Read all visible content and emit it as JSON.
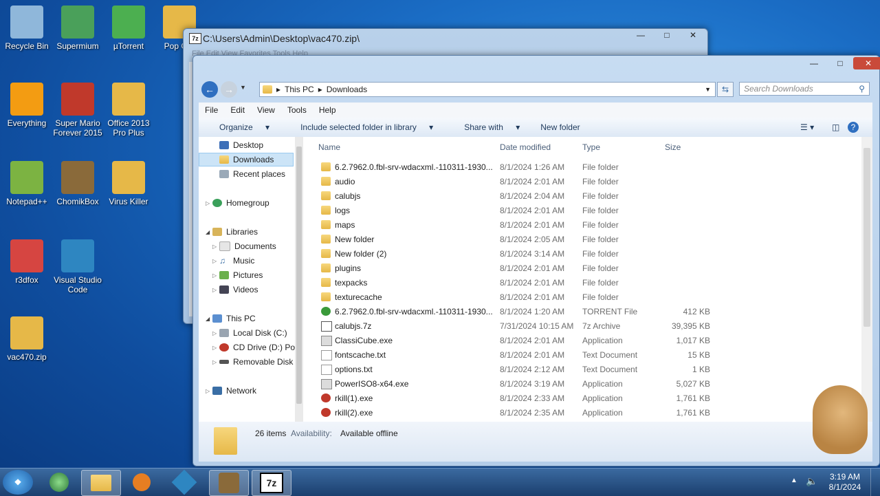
{
  "desktop": {
    "icons": [
      {
        "label": "Recycle Bin",
        "icon": "recycle-bin-icon"
      },
      {
        "label": "Supermium",
        "icon": "browser-icon"
      },
      {
        "label": "µTorrent",
        "icon": "utorrent-icon"
      },
      {
        "label": "Pop Gar",
        "icon": "folder-icon"
      },
      {
        "label": "Everything",
        "icon": "search-icon"
      },
      {
        "label": "Super Mario Forever 2015",
        "icon": "mario-icon"
      },
      {
        "label": "Office 2013 Pro Plus",
        "icon": "folder-icon"
      },
      {
        "label": "Notepad++",
        "icon": "notepad-icon"
      },
      {
        "label": "ChomikBox",
        "icon": "chomikbox-icon"
      },
      {
        "label": "Virus Killer",
        "icon": "folder-icon"
      },
      {
        "label": "r3dfox",
        "icon": "fox-icon"
      },
      {
        "label": "Visual Studio Code",
        "icon": "vscode-icon"
      },
      {
        "label": "vac470.zip",
        "icon": "zip-icon"
      }
    ]
  },
  "window_7z": {
    "title": "C:\\Users\\Admin\\Desktop\\vac470.zip\\",
    "menu": "File  Edit  View  Favorites  Tools  Help"
  },
  "explorer": {
    "breadcrumb": [
      "This PC",
      "Downloads"
    ],
    "search_placeholder": "Search Downloads",
    "menu": [
      "File",
      "Edit",
      "View",
      "Tools",
      "Help"
    ],
    "toolbar": [
      "Organize",
      "Include selected folder in library",
      "Share with",
      "New folder"
    ],
    "nav": {
      "favorites": [
        "Desktop",
        "Downloads",
        "Recent places"
      ],
      "homegroup": "Homegroup",
      "libraries": "Libraries",
      "library_items": [
        "Documents",
        "Music",
        "Pictures",
        "Videos"
      ],
      "this_pc": "This PC",
      "drives": [
        "Local Disk (C:)",
        "CD Drive (D:) Pop",
        "Removable Disk ("
      ],
      "network": "Network"
    },
    "columns": {
      "name": "Name",
      "date": "Date modified",
      "type": "Type",
      "size": "Size"
    },
    "files": [
      {
        "name": "6.2.7962.0.fbl-srv-wdacxml.-110311-1930...",
        "date": "8/1/2024 1:26 AM",
        "type": "File folder",
        "size": "",
        "kind": "folder"
      },
      {
        "name": "audio",
        "date": "8/1/2024 2:01 AM",
        "type": "File folder",
        "size": "",
        "kind": "folder"
      },
      {
        "name": "calubjs",
        "date": "8/1/2024 2:04 AM",
        "type": "File folder",
        "size": "",
        "kind": "folder"
      },
      {
        "name": "logs",
        "date": "8/1/2024 2:01 AM",
        "type": "File folder",
        "size": "",
        "kind": "folder"
      },
      {
        "name": "maps",
        "date": "8/1/2024 2:01 AM",
        "type": "File folder",
        "size": "",
        "kind": "folder"
      },
      {
        "name": "New folder",
        "date": "8/1/2024 2:05 AM",
        "type": "File folder",
        "size": "",
        "kind": "folder"
      },
      {
        "name": "New folder (2)",
        "date": "8/1/2024 3:14 AM",
        "type": "File folder",
        "size": "",
        "kind": "folder"
      },
      {
        "name": "plugins",
        "date": "8/1/2024 2:01 AM",
        "type": "File folder",
        "size": "",
        "kind": "folder"
      },
      {
        "name": "texpacks",
        "date": "8/1/2024 2:01 AM",
        "type": "File folder",
        "size": "",
        "kind": "folder"
      },
      {
        "name": "texturecache",
        "date": "8/1/2024 2:01 AM",
        "type": "File folder",
        "size": "",
        "kind": "folder"
      },
      {
        "name": "6.2.7962.0.fbl-srv-wdacxml.-110311-1930...",
        "date": "8/1/2024 1:20 AM",
        "type": "TORRENT File",
        "size": "412 KB",
        "kind": "torrent"
      },
      {
        "name": "calubjs.7z",
        "date": "7/31/2024 10:15 AM",
        "type": "7z Archive",
        "size": "39,395 KB",
        "kind": "archive"
      },
      {
        "name": "ClassiCube.exe",
        "date": "8/1/2024 2:01 AM",
        "type": "Application",
        "size": "1,017 KB",
        "kind": "exe"
      },
      {
        "name": "fontscache.txt",
        "date": "8/1/2024 2:01 AM",
        "type": "Text Document",
        "size": "15 KB",
        "kind": "txt"
      },
      {
        "name": "options.txt",
        "date": "8/1/2024 2:12 AM",
        "type": "Text Document",
        "size": "1 KB",
        "kind": "txt"
      },
      {
        "name": "PowerISO8-x64.exe",
        "date": "8/1/2024 3:19 AM",
        "type": "Application",
        "size": "5,027 KB",
        "kind": "exe"
      },
      {
        "name": "rkill(1).exe",
        "date": "8/1/2024 2:33 AM",
        "type": "Application",
        "size": "1,761 KB",
        "kind": "rkill"
      },
      {
        "name": "rkill(2).exe",
        "date": "8/1/2024 2:35 AM",
        "type": "Application",
        "size": "1,761 KB",
        "kind": "rkill"
      }
    ],
    "status": {
      "count": "26 items",
      "availability_label": "Availability:",
      "availability_value": "Available offline"
    }
  },
  "taskbar": {
    "clock_time": "3:19 AM",
    "clock_date": "8/1/2024"
  },
  "colors": {
    "accent": "#1a6cc4",
    "folder": "#e6b848"
  }
}
